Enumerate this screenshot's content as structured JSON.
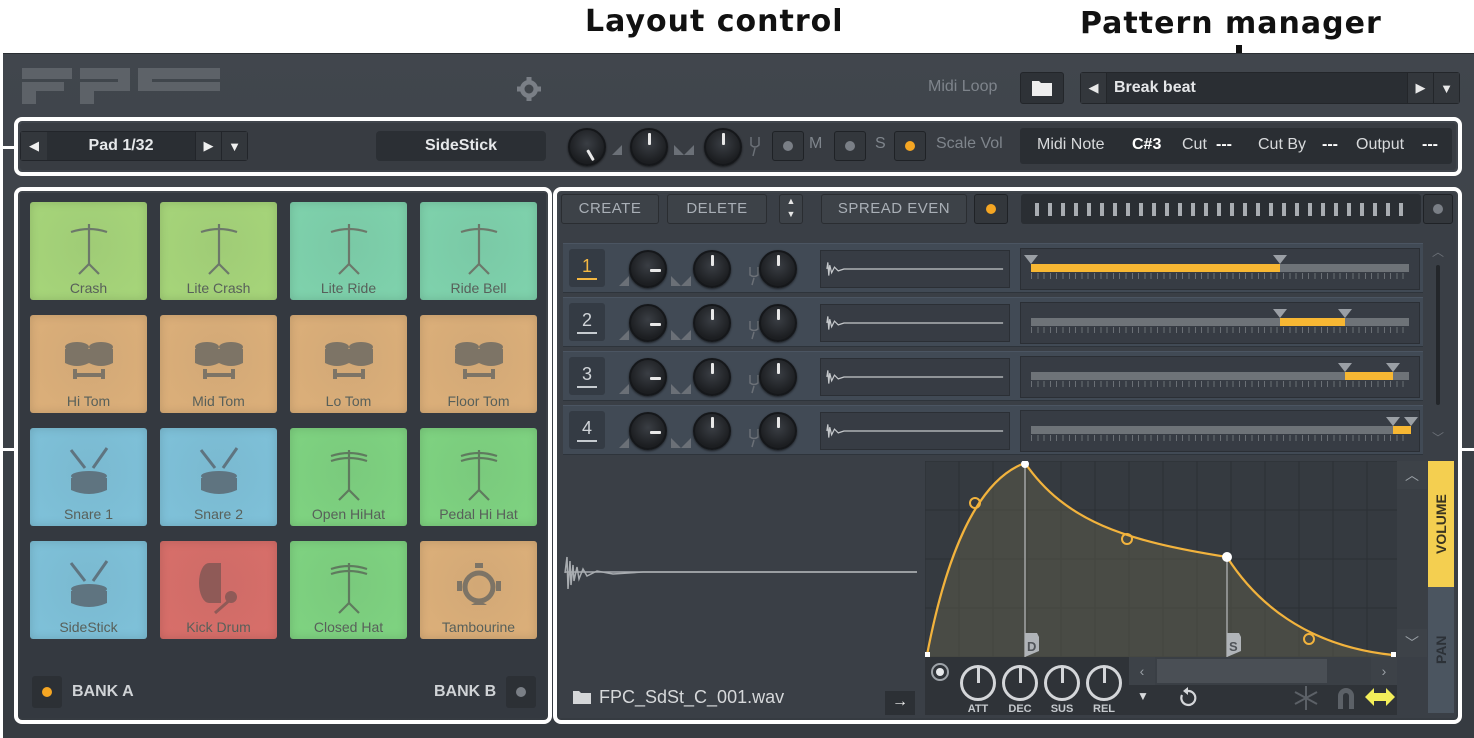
{
  "annotations": {
    "layout_control": "Layout control",
    "pattern_manager": "Pattern manager"
  },
  "header": {
    "logo": "FPC",
    "midi_loop_label": "Midi Loop",
    "pattern_name": "Break beat"
  },
  "toolbar": {
    "pad_selector": "Pad 1/32",
    "pad_name": "SideStick",
    "mute_label": "M",
    "solo_label": "S",
    "scale_vol_label": "Scale Vol",
    "scale_vol_on": true,
    "midi_note_label": "Midi Note",
    "midi_note_value": "C#3",
    "cut_label": "Cut",
    "cut_value": "---",
    "cut_by_label": "Cut By",
    "cut_by_value": "---",
    "output_label": "Output",
    "output_value": "---"
  },
  "pads": [
    {
      "label": "Crash",
      "icon": "cymbal-icon",
      "color": "#a7d67a"
    },
    {
      "label": "Lite Crash",
      "icon": "cymbal-icon",
      "color": "#a7d67a"
    },
    {
      "label": "Lite Ride",
      "icon": "cymbal-icon",
      "color": "#7fd3ad"
    },
    {
      "label": "Ride Bell",
      "icon": "cymbal-icon",
      "color": "#7fd3ad"
    },
    {
      "label": "Hi Tom",
      "icon": "toms-icon",
      "color": "#ddb07a"
    },
    {
      "label": "Mid Tom",
      "icon": "toms-icon",
      "color": "#ddb07a"
    },
    {
      "label": "Lo Tom",
      "icon": "toms-icon",
      "color": "#ddb07a"
    },
    {
      "label": "Floor Tom",
      "icon": "toms-icon",
      "color": "#ddb07a"
    },
    {
      "label": "Snare 1",
      "icon": "snare-icon",
      "color": "#7fc2da"
    },
    {
      "label": "Snare 2",
      "icon": "snare-icon",
      "color": "#7fc2da"
    },
    {
      "label": "Open HiHat",
      "icon": "hihat-icon",
      "color": "#7fd481"
    },
    {
      "label": "Pedal Hi Hat",
      "icon": "hihat-icon",
      "color": "#7fd481"
    },
    {
      "label": "SideStick",
      "icon": "snare-icon",
      "color": "#7fc2da"
    },
    {
      "label": "Kick Drum",
      "icon": "kick-icon",
      "color": "#d96f6a"
    },
    {
      "label": "Closed Hat",
      "icon": "hihat-icon",
      "color": "#7fd481"
    },
    {
      "label": "Tambourine",
      "icon": "tambourine-icon",
      "color": "#ddb07a"
    }
  ],
  "banks": {
    "bank_a": "BANK A",
    "bank_b": "BANK B",
    "active": "A"
  },
  "layers_toolbar": {
    "create": "CREATE",
    "delete": "DELETE",
    "spread_even": "SPREAD EVEN"
  },
  "layers": [
    {
      "number": "1",
      "active": true,
      "velocity_start": 0.0,
      "velocity_end": 0.656
    },
    {
      "number": "2",
      "active": false,
      "velocity_start": 0.656,
      "velocity_end": 0.826
    },
    {
      "number": "3",
      "active": false,
      "velocity_start": 0.826,
      "velocity_end": 0.953
    },
    {
      "number": "4",
      "active": false,
      "velocity_start": 0.953,
      "velocity_end": 1.0
    }
  ],
  "sample": {
    "filename": "FPC_SdSt_C_001.wav"
  },
  "envelope": {
    "markers": [
      "D",
      "S"
    ],
    "knobs": [
      "ATT",
      "DEC",
      "SUS",
      "REL"
    ],
    "tabs": [
      "VOLUME",
      "PAN"
    ],
    "active_tab": "VOLUME"
  },
  "colors": {
    "accent": "#f5a623",
    "velocity_fill": "#f7b733",
    "envelope_line": "#f2b33d",
    "active_tab": "#f4cf50"
  }
}
